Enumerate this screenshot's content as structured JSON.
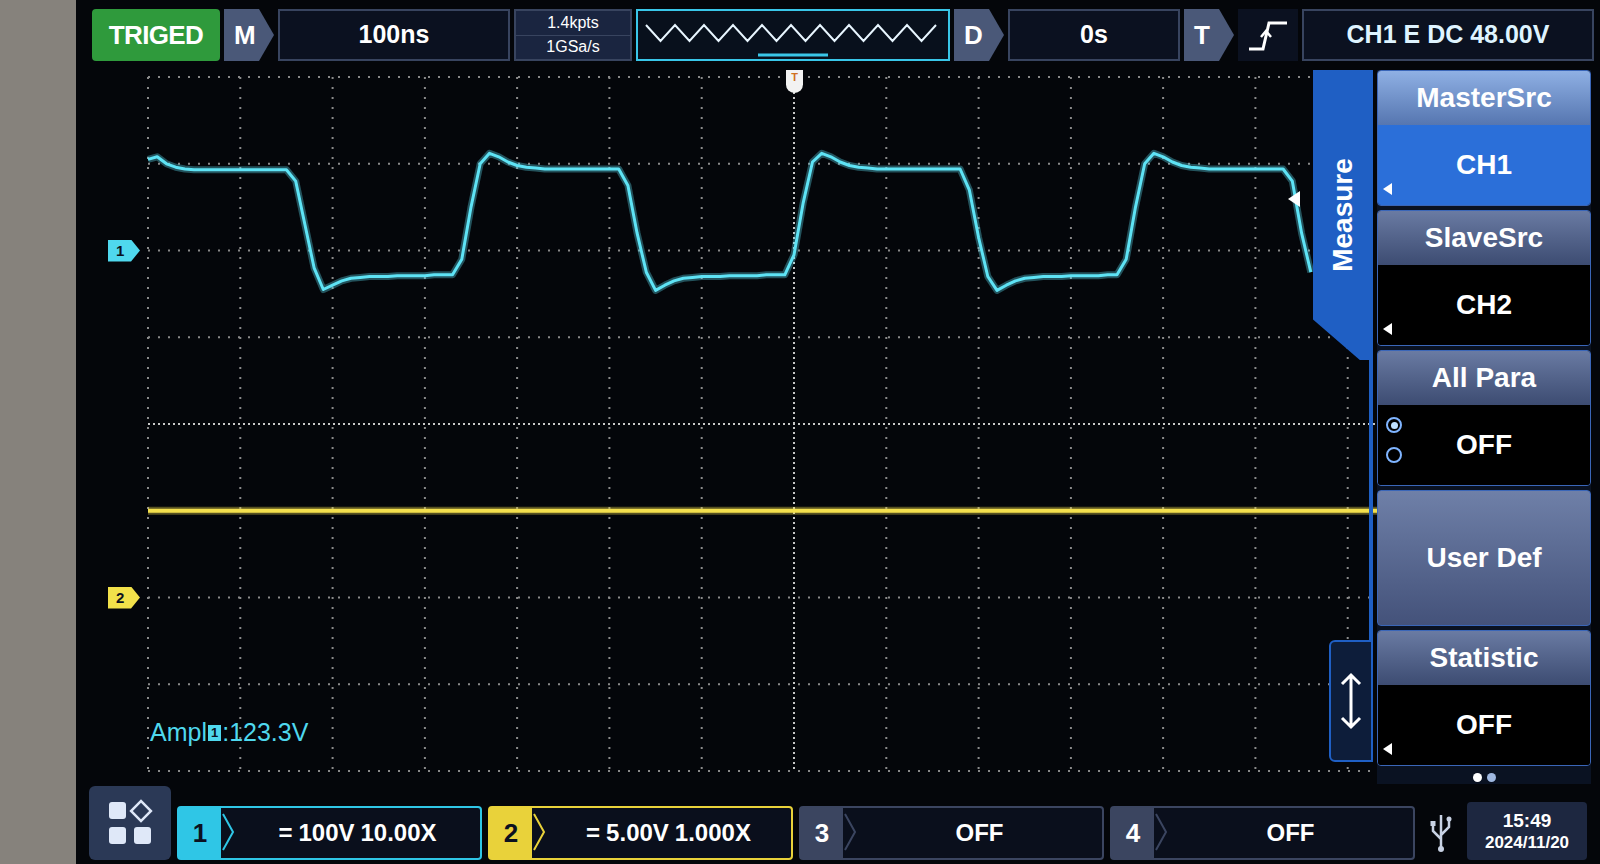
{
  "status": {
    "trigger_state": "TRIGED",
    "mode": "M",
    "timebase": "100ns",
    "memory_depth": "1.4kpts",
    "sample_rate": "1GSa/s",
    "delay_label": "D",
    "delay": "0s",
    "trigger_label": "T",
    "trigger": "CH1 E DC 48.00V"
  },
  "chart": {
    "channel_markers": [
      {
        "label": "1",
        "color": "#4fd8ee"
      },
      {
        "label": "2",
        "color": "#f2e14a"
      }
    ],
    "trigger_marker": "T",
    "series": [
      {
        "color": "#5ee3f5",
        "step_ns": 10,
        "values": [
          105,
          108,
          100,
          96,
          94,
          93,
          93,
          93,
          93,
          93,
          93,
          93,
          93,
          93,
          93,
          93,
          80,
          30,
          -20,
          -45,
          -40,
          -35,
          -32,
          -31,
          -30,
          -30,
          -30,
          -29,
          -29,
          -29,
          -29,
          -28,
          -28,
          -28,
          -10,
          50,
          100,
          112,
          108,
          102,
          98,
          96,
          95,
          94,
          94,
          94,
          94,
          94,
          94,
          94,
          94,
          94,
          75,
          20,
          -25,
          -46,
          -40,
          -35,
          -32,
          -31,
          -30,
          -30,
          -30,
          -29,
          -29,
          -29,
          -29,
          -28,
          -28,
          -28,
          -5,
          55,
          102,
          112,
          108,
          102,
          98,
          96,
          95,
          94,
          94,
          94,
          94,
          94,
          94,
          94,
          94,
          94,
          94,
          70,
          15,
          -30,
          -46,
          -40,
          -35,
          -32,
          -31,
          -30,
          -30,
          -30,
          -29,
          -29,
          -29,
          -29,
          -28,
          -28,
          -10,
          50,
          100,
          112,
          108,
          102,
          98,
          96,
          95,
          94,
          94,
          94,
          94,
          94,
          94,
          94,
          94,
          94,
          80,
          20,
          -25
        ]
      },
      {
        "color": "#f4e04d",
        "step_ns": 100,
        "values": [
          5,
          5,
          5,
          5,
          5,
          5,
          5,
          5,
          5,
          5,
          5,
          5,
          5,
          5,
          5
        ]
      }
    ],
    "measurement": {
      "name": "Ampl",
      "channel": "1",
      "value": ":123.3V"
    }
  },
  "menu": {
    "title": "Measure",
    "items": [
      {
        "kind": "select",
        "label": "MasterSrc",
        "value": "CH1",
        "selected": true
      },
      {
        "kind": "select",
        "label": "SlaveSrc",
        "value": "CH2",
        "selected": false
      },
      {
        "kind": "radio",
        "label": "All Para",
        "value": "OFF",
        "options": [
          {
            "selected": true
          },
          {
            "selected": false
          }
        ]
      },
      {
        "kind": "button",
        "label": "User Def"
      },
      {
        "kind": "select",
        "label": "Statistic",
        "value": "OFF",
        "selected": false
      }
    ],
    "pages": [
      {
        "selected": true
      },
      {
        "selected": false
      }
    ]
  },
  "channels": [
    {
      "number": "1",
      "coupling": "=",
      "scale": "100V",
      "probe": "10.00X",
      "on": true,
      "color": "#2fc6e6"
    },
    {
      "number": "2",
      "coupling": "=",
      "scale": "5.00V",
      "probe": "1.000X",
      "on": true,
      "color": "#e9d23a"
    },
    {
      "number": "3",
      "value": "OFF",
      "on": false
    },
    {
      "number": "4",
      "value": "OFF",
      "on": false
    }
  ],
  "clock": {
    "time": "15:49",
    "date": "2024/11/20"
  }
}
